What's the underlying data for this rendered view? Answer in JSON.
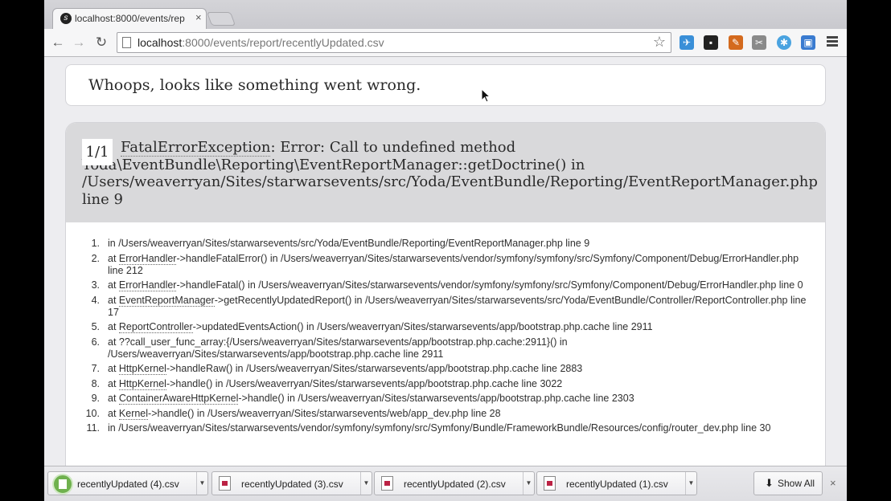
{
  "tab": {
    "title": "localhost:8000/events/rep",
    "close": "×"
  },
  "toolbar": {
    "url_host": "localhost",
    "url_rest": ":8000/events/report/recentlyUpdated.csv"
  },
  "page": {
    "whoops": "Whoops, looks like something went wrong.",
    "counter": "1/1",
    "exception_name": "FatalErrorException",
    "exception_message": ": Error: Call to undefined method Yoda\\EventBundle\\Reporting\\EventReportManager::getDoctrine() in /Users/weaverryan/Sites/starwarsevents/src/Yoda/EventBundle/Reporting/EventReportManager.php line 9",
    "trace": [
      {
        "num": "1.",
        "prefix": "in /Users/weaverryan/Sites/starwarsevents/src/Yoda/EventBundle/Reporting/EventReportManager.php line 9",
        "cls": "",
        "rest": ""
      },
      {
        "num": "2.",
        "prefix": "at ",
        "cls": "ErrorHandler",
        "rest": "->handleFatalError() in /Users/weaverryan/Sites/starwarsevents/vendor/symfony/symfony/src/Symfony/Component/Debug/ErrorHandler.php line 212"
      },
      {
        "num": "3.",
        "prefix": "at ",
        "cls": "ErrorHandler",
        "rest": "->handleFatal() in /Users/weaverryan/Sites/starwarsevents/vendor/symfony/symfony/src/Symfony/Component/Debug/ErrorHandler.php line 0"
      },
      {
        "num": "4.",
        "prefix": "at ",
        "cls": "EventReportManager",
        "rest": "->getRecentlyUpdatedReport() in /Users/weaverryan/Sites/starwarsevents/src/Yoda/EventBundle/Controller/ReportController.php line 17"
      },
      {
        "num": "5.",
        "prefix": "at ",
        "cls": "ReportController",
        "rest": "->updatedEventsAction() in /Users/weaverryan/Sites/starwarsevents/app/bootstrap.php.cache line 2911"
      },
      {
        "num": "6.",
        "prefix": "at ??call_user_func_array:{/Users/weaverryan/Sites/starwarsevents/app/bootstrap.php.cache:2911}() in /Users/weaverryan/Sites/starwarsevents/app/bootstrap.php.cache line 2911",
        "cls": "",
        "rest": ""
      },
      {
        "num": "7.",
        "prefix": "at ",
        "cls": "HttpKernel",
        "rest": "->handleRaw() in /Users/weaverryan/Sites/starwarsevents/app/bootstrap.php.cache line 2883"
      },
      {
        "num": "8.",
        "prefix": "at ",
        "cls": "HttpKernel",
        "rest": "->handle() in /Users/weaverryan/Sites/starwarsevents/app/bootstrap.php.cache line 3022"
      },
      {
        "num": "9.",
        "prefix": "at ",
        "cls": "ContainerAwareHttpKernel",
        "rest": "->handle() in /Users/weaverryan/Sites/starwarsevents/app/bootstrap.php.cache line 2303"
      },
      {
        "num": "10.",
        "prefix": "at ",
        "cls": "Kernel",
        "rest": "->handle() in /Users/weaverryan/Sites/starwarsevents/web/app_dev.php line 28"
      },
      {
        "num": "11.",
        "prefix": "in /Users/weaverryan/Sites/starwarsevents/vendor/symfony/symfony/src/Symfony/Bundle/FrameworkBundle/Resources/config/router_dev.php line 30",
        "cls": "",
        "rest": ""
      }
    ]
  },
  "downloads": [
    {
      "name": "recentlyUpdated (4).csv",
      "icon": "progress-icon"
    },
    {
      "name": "recentlyUpdated (3).csv",
      "icon": "file-icon"
    },
    {
      "name": "recentlyUpdated (2).csv",
      "icon": "file-icon"
    },
    {
      "name": "recentlyUpdated (1).csv",
      "icon": "file-icon"
    }
  ],
  "shelf": {
    "show_all": "Show All",
    "close": "×"
  },
  "colors": {
    "page_bg": "#ededf0",
    "header_bg": "#d9d9db",
    "panel_bg": "#ffffff"
  }
}
